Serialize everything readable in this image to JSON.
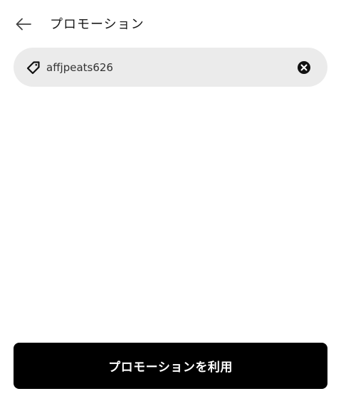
{
  "header": {
    "back_icon": "arrow-left-icon",
    "title": "プロモーション"
  },
  "promo": {
    "tag_icon": "tag-icon",
    "value": "affjpeats626",
    "clear_icon": "close-circle-icon"
  },
  "footer": {
    "apply_label": "プロモーションを利用"
  },
  "colors": {
    "field_bg": "#ebebeb",
    "button_bg": "#000000",
    "button_text": "#ffffff"
  }
}
